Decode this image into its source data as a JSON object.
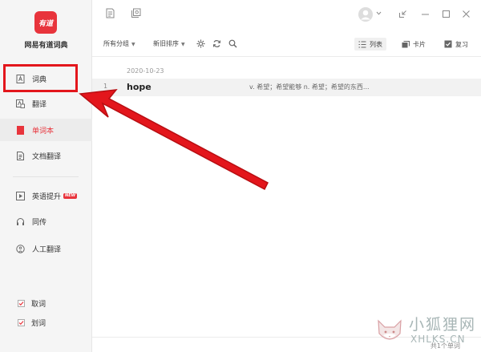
{
  "app": {
    "logo_text": "有道",
    "name": "网易有道词典"
  },
  "sidebar": {
    "items": [
      {
        "label": "词典",
        "icon": "dict-icon"
      },
      {
        "label": "翻译",
        "icon": "translate-icon"
      },
      {
        "label": "单词本",
        "icon": "wordbook-icon"
      },
      {
        "label": "文档翻译",
        "icon": "document-icon"
      },
      {
        "label": "英语提升",
        "icon": "play-icon",
        "badge": "NEW"
      },
      {
        "label": "同传",
        "icon": "headset-icon"
      },
      {
        "label": "人工翻译",
        "icon": "human-icon"
      }
    ],
    "checks": [
      {
        "label": "取词",
        "checked": true
      },
      {
        "label": "划词",
        "checked": true
      }
    ]
  },
  "toolbar": {
    "group_filter": "所有分组",
    "sort": "新旧排序",
    "list_label": "列表",
    "card_label": "卡片",
    "review_label": "复习"
  },
  "wordlist": {
    "date": "2020-10-23",
    "rows": [
      {
        "num": "1",
        "word": "hope",
        "definition": "v. 希望；希望能够  n. 希望；希望的东西..."
      }
    ]
  },
  "footer": {
    "count": "共1个单词"
  },
  "watermark": {
    "title": "小狐狸网",
    "subtitle": "XHLKS.CN"
  },
  "colors": {
    "accent": "#e8343c",
    "highlight": "#e3161c"
  }
}
